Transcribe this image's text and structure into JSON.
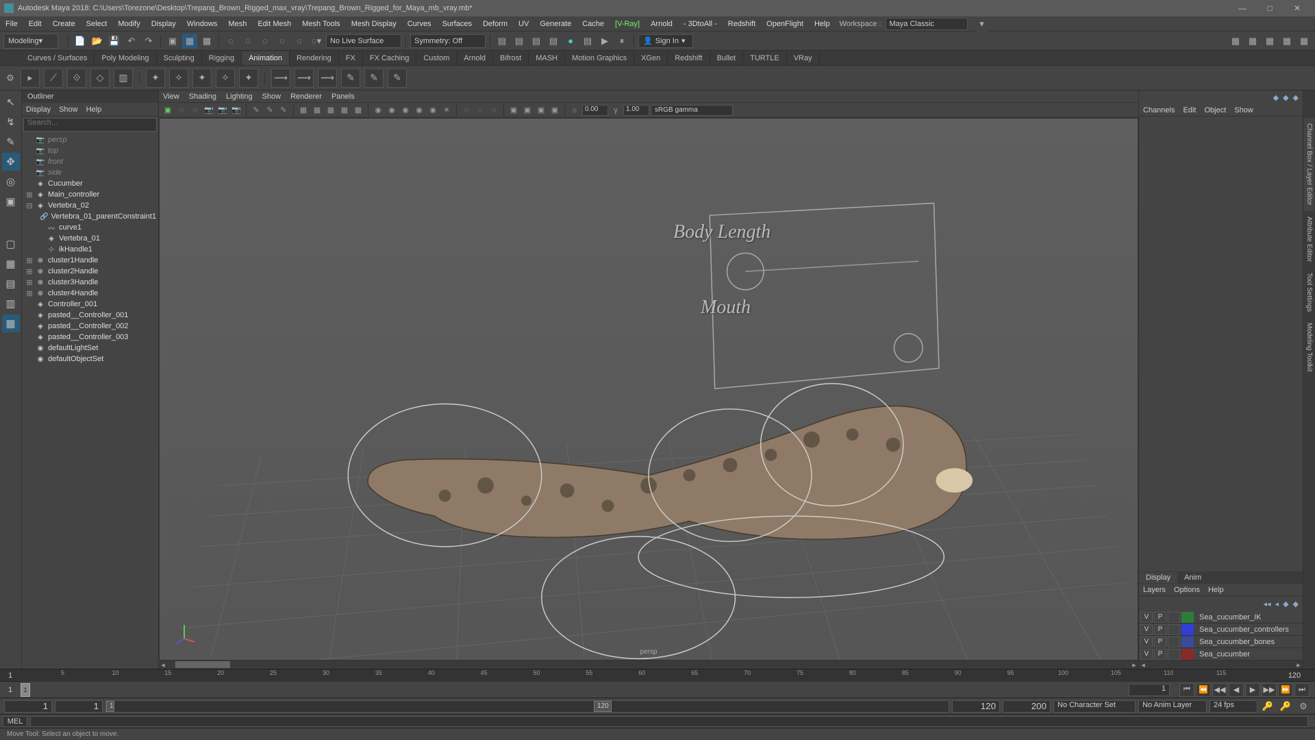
{
  "title": "Autodesk Maya 2018: C:\\Users\\Torezone\\Desktop\\Trepang_Brown_Rigged_max_vray\\Trepang_Brown_Rigged_for_Maya_mb_vray.mb*",
  "menus": [
    "File",
    "Edit",
    "Create",
    "Select",
    "Modify",
    "Display",
    "Windows",
    "Mesh",
    "Edit Mesh",
    "Mesh Tools",
    "Mesh Display",
    "Curves",
    "Surfaces",
    "Deform",
    "UV",
    "Generate",
    "Cache",
    "[V-Ray]",
    "Arnold",
    "- 3DtoAll -",
    "Redshift",
    "OpenFlight",
    "Help"
  ],
  "workspace": {
    "label": "Workspace :",
    "value": "Maya Classic"
  },
  "module": "Modeling",
  "status": {
    "live": "No Live Surface",
    "symmetry": "Symmetry: Off",
    "signin": "Sign In"
  },
  "shelf_tabs": [
    "Curves / Surfaces",
    "Poly Modeling",
    "Sculpting",
    "Rigging",
    "Animation",
    "Rendering",
    "FX",
    "FX Caching",
    "Custom",
    "Arnold",
    "Bifrost",
    "MASH",
    "Motion Graphics",
    "XGen",
    "Redshift",
    "Bullet",
    "TURTLE",
    "VRay"
  ],
  "shelf_active": "Animation",
  "outliner": {
    "title": "Outliner",
    "menu": [
      "Display",
      "Show",
      "Help"
    ],
    "search": "Search...",
    "items": [
      {
        "indent": 0,
        "exp": "",
        "icon": "📷",
        "label": "persp",
        "dim": true
      },
      {
        "indent": 0,
        "exp": "",
        "icon": "📷",
        "label": "top",
        "dim": true
      },
      {
        "indent": 0,
        "exp": "",
        "icon": "📷",
        "label": "front",
        "dim": true
      },
      {
        "indent": 0,
        "exp": "",
        "icon": "📷",
        "label": "side",
        "dim": true
      },
      {
        "indent": 0,
        "exp": "",
        "icon": "◈",
        "label": "Cucumber"
      },
      {
        "indent": 0,
        "exp": "⊞",
        "icon": "◈",
        "label": "Main_controller"
      },
      {
        "indent": 0,
        "exp": "⊟",
        "icon": "◈",
        "label": "Vertebra_02"
      },
      {
        "indent": 1,
        "exp": "",
        "icon": "🔗",
        "label": "Vertebra_01_parentConstraint1"
      },
      {
        "indent": 1,
        "exp": "",
        "icon": "〰",
        "label": "curve1"
      },
      {
        "indent": 1,
        "exp": "",
        "icon": "◈",
        "label": "Vertebra_01"
      },
      {
        "indent": 1,
        "exp": "",
        "icon": "⊹",
        "label": "ikHandle1"
      },
      {
        "indent": 0,
        "exp": "⊞",
        "icon": "⊕",
        "label": "cluster1Handle"
      },
      {
        "indent": 0,
        "exp": "⊞",
        "icon": "⊕",
        "label": "cluster2Handle"
      },
      {
        "indent": 0,
        "exp": "⊞",
        "icon": "⊕",
        "label": "cluster3Handle"
      },
      {
        "indent": 0,
        "exp": "⊞",
        "icon": "⊕",
        "label": "cluster4Handle"
      },
      {
        "indent": 0,
        "exp": "",
        "icon": "◈",
        "label": "Controller_001"
      },
      {
        "indent": 0,
        "exp": "",
        "icon": "◈",
        "label": "pasted__Controller_001"
      },
      {
        "indent": 0,
        "exp": "",
        "icon": "◈",
        "label": "pasted__Controller_002"
      },
      {
        "indent": 0,
        "exp": "",
        "icon": "◈",
        "label": "pasted__Controller_003"
      },
      {
        "indent": 0,
        "exp": "",
        "icon": "◉",
        "label": "defaultLightSet"
      },
      {
        "indent": 0,
        "exp": "",
        "icon": "◉",
        "label": "defaultObjectSet"
      }
    ]
  },
  "viewport": {
    "menu": [
      "View",
      "Shading",
      "Lighting",
      "Show",
      "Renderer",
      "Panels"
    ],
    "opacity": "0.00",
    "gamma": "1.00",
    "cs": "sRGB gamma",
    "camera": "persp",
    "hud": {
      "lbl1": "Body Length",
      "lbl2": "Mouth"
    }
  },
  "channel": {
    "menu": [
      "Channels",
      "Edit",
      "Object",
      "Show"
    ],
    "tabs": [
      "Display",
      "Anim"
    ],
    "layer_menu": [
      "Layers",
      "Options",
      "Help"
    ],
    "layers": [
      {
        "v": "V",
        "p": "P",
        "color": "#2d7d3a",
        "name": "Sea_cucumber_IK"
      },
      {
        "v": "V",
        "p": "P",
        "color": "#2e3ed6",
        "name": "Sea_cucumber_controllers"
      },
      {
        "v": "V",
        "p": "P",
        "color": "#3a4a9a",
        "name": "Sea_cucumber_bones"
      },
      {
        "v": "V",
        "p": "P",
        "color": "#8a2a2a",
        "name": "Sea_cucumber"
      }
    ]
  },
  "right_tabs": [
    "Channel Box / Layer Editor",
    "Attribute Editor",
    "Tool Settings",
    "Modeling Toolkit"
  ],
  "timeslider": {
    "start": "1",
    "end": "120",
    "ticks": [
      5,
      10,
      15,
      20,
      25,
      30,
      35,
      40,
      45,
      50,
      55,
      60,
      65,
      70,
      75,
      80,
      85,
      90,
      95,
      100,
      105,
      110,
      115
    ]
  },
  "play": {
    "start": "1",
    "current": "1",
    "cursor": "1"
  },
  "range": {
    "a": "1",
    "b": "1",
    "c": "120",
    "d": "200",
    "handleA": "1",
    "handleB": "120",
    "charset": "No Character Set",
    "animlayer": "No Anim Layer",
    "fps": "24 fps"
  },
  "cmd": {
    "lang": "MEL"
  },
  "help": "Move Tool: Select an object to move."
}
